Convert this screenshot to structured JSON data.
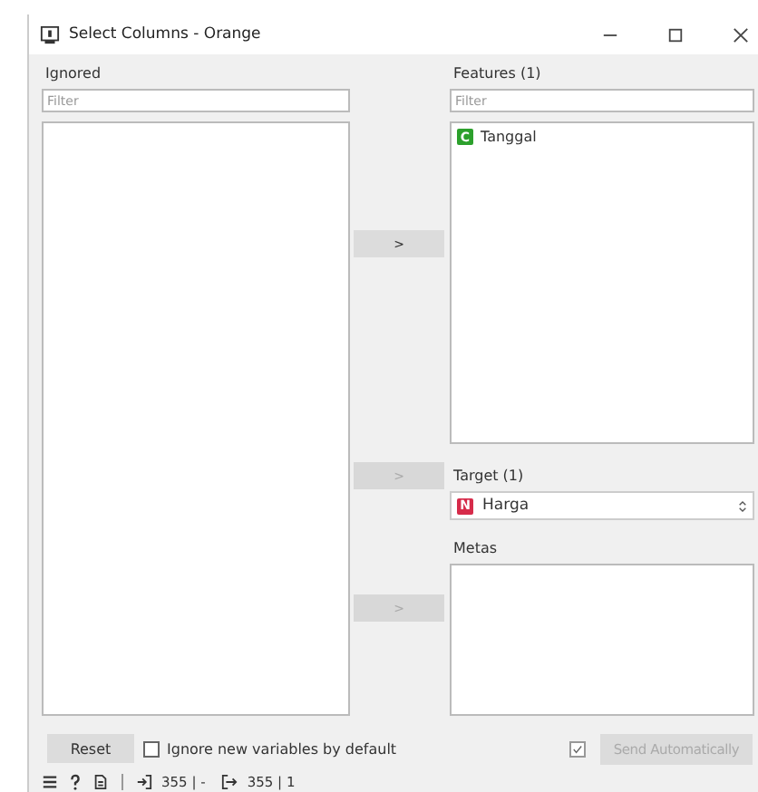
{
  "window": {
    "title": "Select Columns - Orange"
  },
  "ignored": {
    "title": "Ignored",
    "filter_placeholder": "Filter"
  },
  "features": {
    "title": "Features (1)",
    "filter_placeholder": "Filter",
    "items": [
      {
        "type": "C",
        "name": "Tanggal",
        "color": "#2ca02c"
      }
    ]
  },
  "target": {
    "title": "Target (1)",
    "value": {
      "type": "N",
      "name": "Harga",
      "color": "#d62b4a"
    }
  },
  "metas": {
    "title": "Metas"
  },
  "move_buttons": [
    {
      "label": ">",
      "disabled": false
    },
    {
      "label": ">",
      "disabled": true
    },
    {
      "label": ">",
      "disabled": true
    }
  ],
  "reset_button": "Reset",
  "ignore_new": {
    "label": "Ignore new variables by default",
    "checked": false
  },
  "send_automatically": {
    "label": "Send Automatically",
    "checked": true,
    "disabled": true
  },
  "status_bar": {
    "input_summary": "355 | -",
    "output_summary": "355 | 1"
  }
}
